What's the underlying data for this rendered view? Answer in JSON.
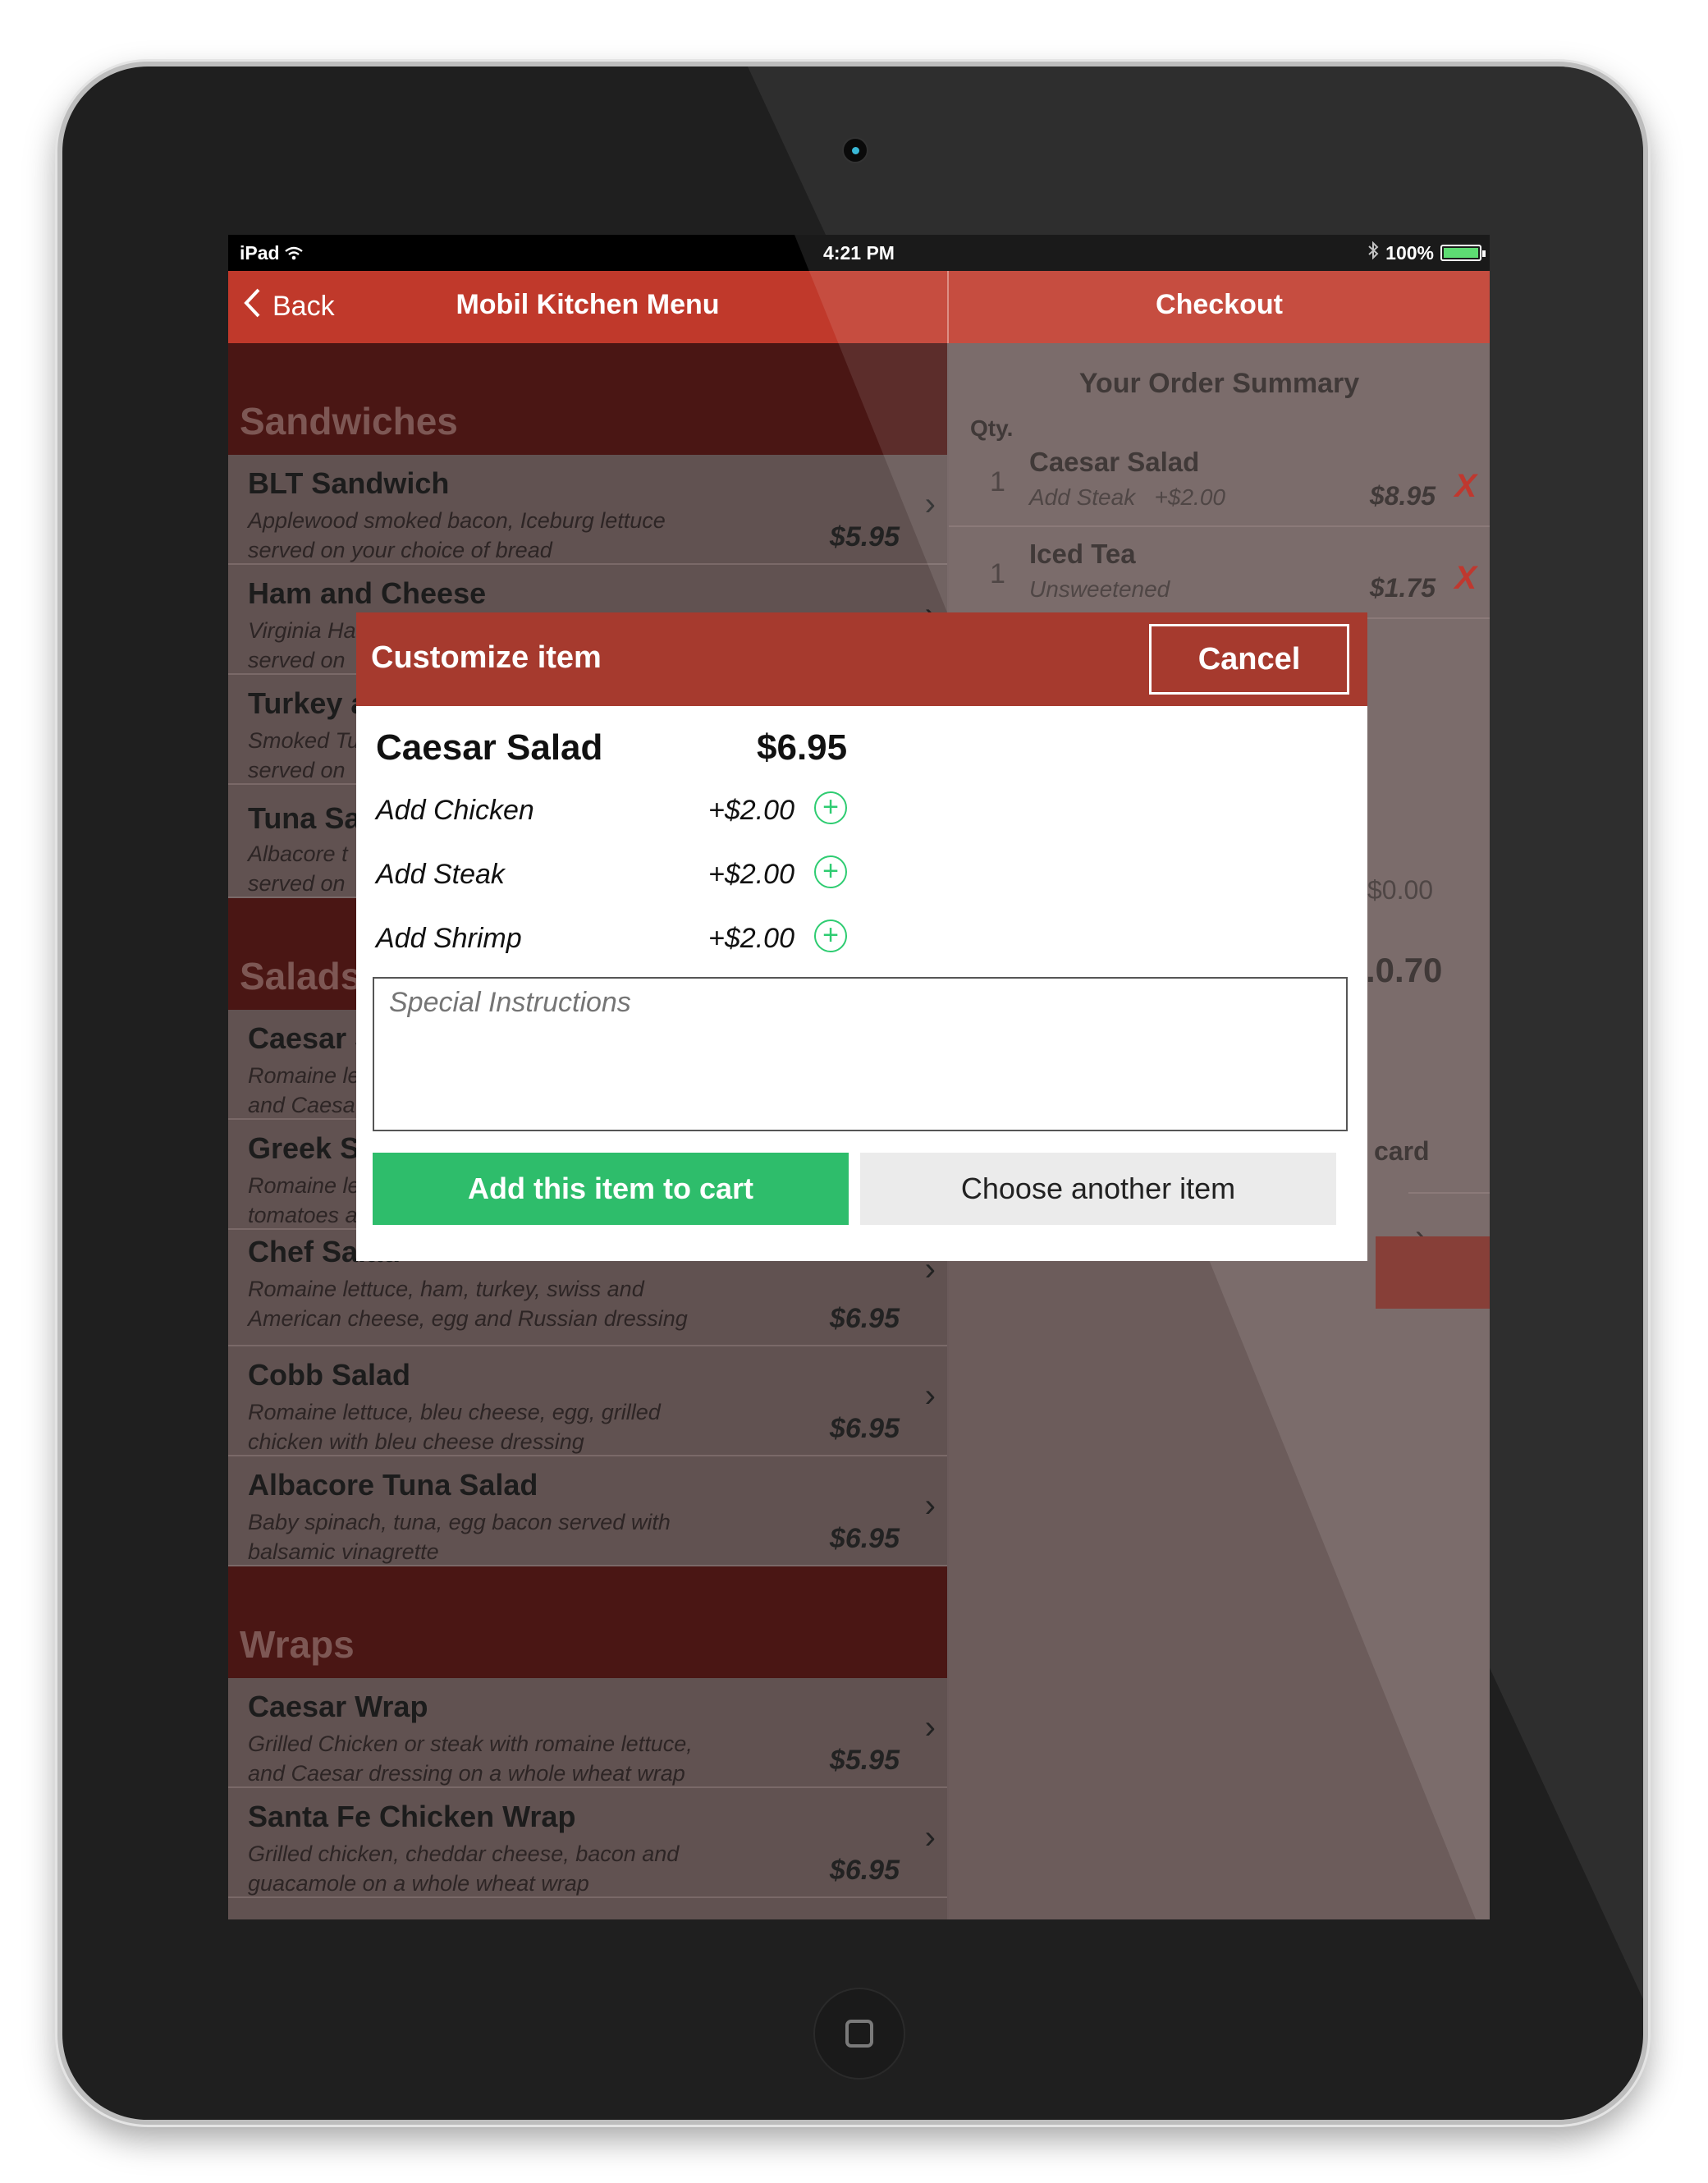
{
  "status_bar": {
    "device": "iPad",
    "time": "4:21 PM",
    "battery": "100%",
    "battery_level": 1.0
  },
  "nav": {
    "back_label": "Back",
    "title": "Mobil Kitchen Menu",
    "checkout_title": "Checkout"
  },
  "menu": {
    "categories": [
      {
        "name": "Sandwiches",
        "items": [
          {
            "name": "BLT Sandwich",
            "desc": "Applewood smoked bacon, Iceburg lettuce served on your choice of bread",
            "price": "$5.95"
          },
          {
            "name": "Ham and Cheese",
            "desc": "Virginia Ha",
            "desc2": "served on",
            "price": ""
          },
          {
            "name": "Turkey a",
            "desc": "Smoked Tu",
            "desc2": "served on",
            "price": ""
          },
          {
            "name": "Tuna Sa",
            "desc": "Albacore t",
            "desc2": "served on",
            "price": ""
          }
        ]
      },
      {
        "name": "Salads",
        "items": [
          {
            "name": "Caesar S",
            "desc": "Romaine le",
            "desc2": "and Caesa",
            "price": ""
          },
          {
            "name": "Greek S",
            "desc": "Romaine le",
            "desc2": "tomatoes a",
            "price": ""
          },
          {
            "name": "Chef Salad",
            "desc": "Romaine lettuce, ham, turkey, swiss and American cheese, egg and Russian dressing",
            "price": "$6.95"
          },
          {
            "name": "Cobb Salad",
            "desc": "Romaine lettuce, bleu cheese, egg, grilled chicken with bleu cheese dressing",
            "price": "$6.95"
          },
          {
            "name": "Albacore Tuna Salad",
            "desc": "Baby spinach, tuna, egg bacon served with balsamic vinagrette",
            "price": "$6.95"
          }
        ]
      },
      {
        "name": "Wraps",
        "items": [
          {
            "name": "Caesar Wrap",
            "desc": "Grilled Chicken or steak with romaine lettuce, and Caesar dressing on a whole wheat wrap",
            "price": "$5.95"
          },
          {
            "name": "Santa Fe Chicken Wrap",
            "desc": "Grilled chicken, cheddar cheese, bacon and guacamole on a  whole wheat wrap",
            "price": "$6.95"
          }
        ]
      }
    ]
  },
  "checkout": {
    "summary_title": "Your Order Summary",
    "qty_label": "Qty.",
    "orders": [
      {
        "qty": "1",
        "name": "Caesar Salad",
        "sub": "Add Steak",
        "sub_price": "+$2.00",
        "price": "$8.95",
        "remove": "X"
      },
      {
        "qty": "1",
        "name": "Iced Tea",
        "sub": "Unsweetened",
        "sub_price": "",
        "price": "$1.75",
        "remove": "X"
      }
    ],
    "partial_fee": "$0.00",
    "partial_total": ".0.70",
    "partial_card": "card"
  },
  "modal": {
    "title": "Customize item",
    "cancel_label": "Cancel",
    "item_name": "Caesar Salad",
    "item_price": "$6.95",
    "options": [
      {
        "name": "Add Chicken",
        "price": "+$2.00"
      },
      {
        "name": "Add Steak",
        "price": "+$2.00"
      },
      {
        "name": "Add Shrimp",
        "price": "+$2.00"
      }
    ],
    "instructions_placeholder": "Special Instructions",
    "add_label": "Add this item to cart",
    "another_label": "Choose another item"
  },
  "colors": {
    "primary_red": "#c0392b",
    "modal_header": "#a63a2e",
    "add_green": "#2ebd6b",
    "remove_red": "#b82218"
  }
}
